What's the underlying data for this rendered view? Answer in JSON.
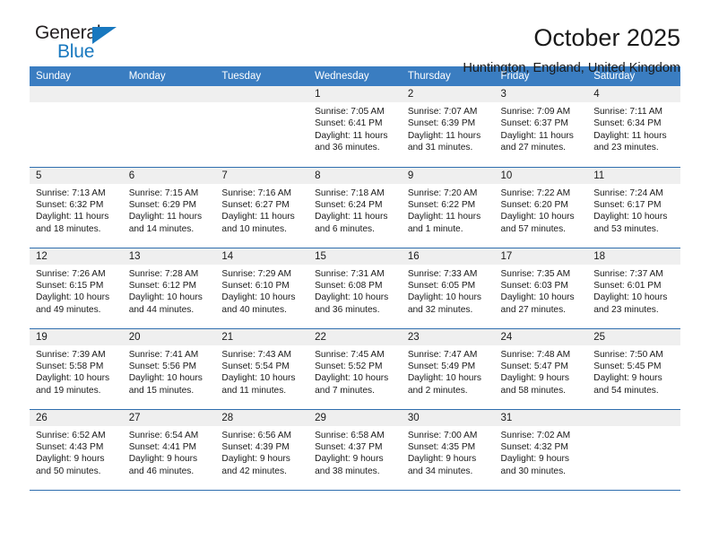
{
  "brand": {
    "name_top": "General",
    "name_bottom": "Blue",
    "accent_color": "#1878bf",
    "triangle_icon": "triangle-icon"
  },
  "header": {
    "title": "October 2025",
    "subtitle": "Huntington, England, United Kingdom"
  },
  "calendar": {
    "header_bg": "#3a7dc1",
    "row_border_color": "#2f6eae",
    "daynum_bg": "#efefef",
    "weekday_headers": [
      "Sunday",
      "Monday",
      "Tuesday",
      "Wednesday",
      "Thursday",
      "Friday",
      "Saturday"
    ],
    "weeks": [
      [
        {
          "date": "",
          "sunrise": "",
          "sunset": "",
          "daylight": ""
        },
        {
          "date": "",
          "sunrise": "",
          "sunset": "",
          "daylight": ""
        },
        {
          "date": "",
          "sunrise": "",
          "sunset": "",
          "daylight": ""
        },
        {
          "date": "1",
          "sunrise": "Sunrise: 7:05 AM",
          "sunset": "Sunset: 6:41 PM",
          "daylight": "Daylight: 11 hours and 36 minutes."
        },
        {
          "date": "2",
          "sunrise": "Sunrise: 7:07 AM",
          "sunset": "Sunset: 6:39 PM",
          "daylight": "Daylight: 11 hours and 31 minutes."
        },
        {
          "date": "3",
          "sunrise": "Sunrise: 7:09 AM",
          "sunset": "Sunset: 6:37 PM",
          "daylight": "Daylight: 11 hours and 27 minutes."
        },
        {
          "date": "4",
          "sunrise": "Sunrise: 7:11 AM",
          "sunset": "Sunset: 6:34 PM",
          "daylight": "Daylight: 11 hours and 23 minutes."
        }
      ],
      [
        {
          "date": "5",
          "sunrise": "Sunrise: 7:13 AM",
          "sunset": "Sunset: 6:32 PM",
          "daylight": "Daylight: 11 hours and 18 minutes."
        },
        {
          "date": "6",
          "sunrise": "Sunrise: 7:15 AM",
          "sunset": "Sunset: 6:29 PM",
          "daylight": "Daylight: 11 hours and 14 minutes."
        },
        {
          "date": "7",
          "sunrise": "Sunrise: 7:16 AM",
          "sunset": "Sunset: 6:27 PM",
          "daylight": "Daylight: 11 hours and 10 minutes."
        },
        {
          "date": "8",
          "sunrise": "Sunrise: 7:18 AM",
          "sunset": "Sunset: 6:24 PM",
          "daylight": "Daylight: 11 hours and 6 minutes."
        },
        {
          "date": "9",
          "sunrise": "Sunrise: 7:20 AM",
          "sunset": "Sunset: 6:22 PM",
          "daylight": "Daylight: 11 hours and 1 minute."
        },
        {
          "date": "10",
          "sunrise": "Sunrise: 7:22 AM",
          "sunset": "Sunset: 6:20 PM",
          "daylight": "Daylight: 10 hours and 57 minutes."
        },
        {
          "date": "11",
          "sunrise": "Sunrise: 7:24 AM",
          "sunset": "Sunset: 6:17 PM",
          "daylight": "Daylight: 10 hours and 53 minutes."
        }
      ],
      [
        {
          "date": "12",
          "sunrise": "Sunrise: 7:26 AM",
          "sunset": "Sunset: 6:15 PM",
          "daylight": "Daylight: 10 hours and 49 minutes."
        },
        {
          "date": "13",
          "sunrise": "Sunrise: 7:28 AM",
          "sunset": "Sunset: 6:12 PM",
          "daylight": "Daylight: 10 hours and 44 minutes."
        },
        {
          "date": "14",
          "sunrise": "Sunrise: 7:29 AM",
          "sunset": "Sunset: 6:10 PM",
          "daylight": "Daylight: 10 hours and 40 minutes."
        },
        {
          "date": "15",
          "sunrise": "Sunrise: 7:31 AM",
          "sunset": "Sunset: 6:08 PM",
          "daylight": "Daylight: 10 hours and 36 minutes."
        },
        {
          "date": "16",
          "sunrise": "Sunrise: 7:33 AM",
          "sunset": "Sunset: 6:05 PM",
          "daylight": "Daylight: 10 hours and 32 minutes."
        },
        {
          "date": "17",
          "sunrise": "Sunrise: 7:35 AM",
          "sunset": "Sunset: 6:03 PM",
          "daylight": "Daylight: 10 hours and 27 minutes."
        },
        {
          "date": "18",
          "sunrise": "Sunrise: 7:37 AM",
          "sunset": "Sunset: 6:01 PM",
          "daylight": "Daylight: 10 hours and 23 minutes."
        }
      ],
      [
        {
          "date": "19",
          "sunrise": "Sunrise: 7:39 AM",
          "sunset": "Sunset: 5:58 PM",
          "daylight": "Daylight: 10 hours and 19 minutes."
        },
        {
          "date": "20",
          "sunrise": "Sunrise: 7:41 AM",
          "sunset": "Sunset: 5:56 PM",
          "daylight": "Daylight: 10 hours and 15 minutes."
        },
        {
          "date": "21",
          "sunrise": "Sunrise: 7:43 AM",
          "sunset": "Sunset: 5:54 PM",
          "daylight": "Daylight: 10 hours and 11 minutes."
        },
        {
          "date": "22",
          "sunrise": "Sunrise: 7:45 AM",
          "sunset": "Sunset: 5:52 PM",
          "daylight": "Daylight: 10 hours and 7 minutes."
        },
        {
          "date": "23",
          "sunrise": "Sunrise: 7:47 AM",
          "sunset": "Sunset: 5:49 PM",
          "daylight": "Daylight: 10 hours and 2 minutes."
        },
        {
          "date": "24",
          "sunrise": "Sunrise: 7:48 AM",
          "sunset": "Sunset: 5:47 PM",
          "daylight": "Daylight: 9 hours and 58 minutes."
        },
        {
          "date": "25",
          "sunrise": "Sunrise: 7:50 AM",
          "sunset": "Sunset: 5:45 PM",
          "daylight": "Daylight: 9 hours and 54 minutes."
        }
      ],
      [
        {
          "date": "26",
          "sunrise": "Sunrise: 6:52 AM",
          "sunset": "Sunset: 4:43 PM",
          "daylight": "Daylight: 9 hours and 50 minutes."
        },
        {
          "date": "27",
          "sunrise": "Sunrise: 6:54 AM",
          "sunset": "Sunset: 4:41 PM",
          "daylight": "Daylight: 9 hours and 46 minutes."
        },
        {
          "date": "28",
          "sunrise": "Sunrise: 6:56 AM",
          "sunset": "Sunset: 4:39 PM",
          "daylight": "Daylight: 9 hours and 42 minutes."
        },
        {
          "date": "29",
          "sunrise": "Sunrise: 6:58 AM",
          "sunset": "Sunset: 4:37 PM",
          "daylight": "Daylight: 9 hours and 38 minutes."
        },
        {
          "date": "30",
          "sunrise": "Sunrise: 7:00 AM",
          "sunset": "Sunset: 4:35 PM",
          "daylight": "Daylight: 9 hours and 34 minutes."
        },
        {
          "date": "31",
          "sunrise": "Sunrise: 7:02 AM",
          "sunset": "Sunset: 4:32 PM",
          "daylight": "Daylight: 9 hours and 30 minutes."
        },
        {
          "date": "",
          "sunrise": "",
          "sunset": "",
          "daylight": ""
        }
      ]
    ]
  }
}
